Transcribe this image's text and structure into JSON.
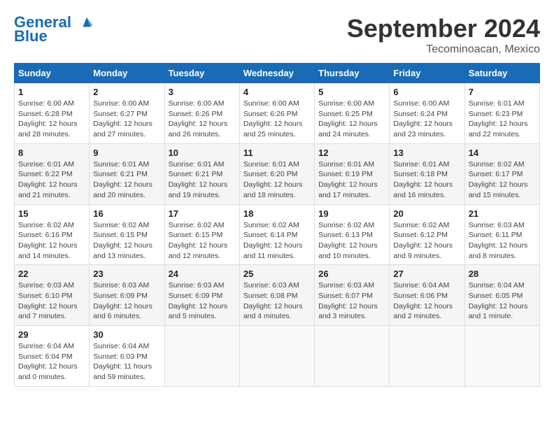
{
  "header": {
    "logo_line1": "General",
    "logo_line2": "Blue",
    "month": "September 2024",
    "location": "Tecominoacan, Mexico"
  },
  "days_of_week": [
    "Sunday",
    "Monday",
    "Tuesday",
    "Wednesday",
    "Thursday",
    "Friday",
    "Saturday"
  ],
  "weeks": [
    [
      {
        "day": "1",
        "info": "Sunrise: 6:00 AM\nSunset: 6:28 PM\nDaylight: 12 hours\nand 28 minutes."
      },
      {
        "day": "2",
        "info": "Sunrise: 6:00 AM\nSunset: 6:27 PM\nDaylight: 12 hours\nand 27 minutes."
      },
      {
        "day": "3",
        "info": "Sunrise: 6:00 AM\nSunset: 6:26 PM\nDaylight: 12 hours\nand 26 minutes."
      },
      {
        "day": "4",
        "info": "Sunrise: 6:00 AM\nSunset: 6:26 PM\nDaylight: 12 hours\nand 25 minutes."
      },
      {
        "day": "5",
        "info": "Sunrise: 6:00 AM\nSunset: 6:25 PM\nDaylight: 12 hours\nand 24 minutes."
      },
      {
        "day": "6",
        "info": "Sunrise: 6:00 AM\nSunset: 6:24 PM\nDaylight: 12 hours\nand 23 minutes."
      },
      {
        "day": "7",
        "info": "Sunrise: 6:01 AM\nSunset: 6:23 PM\nDaylight: 12 hours\nand 22 minutes."
      }
    ],
    [
      {
        "day": "8",
        "info": "Sunrise: 6:01 AM\nSunset: 6:22 PM\nDaylight: 12 hours\nand 21 minutes."
      },
      {
        "day": "9",
        "info": "Sunrise: 6:01 AM\nSunset: 6:21 PM\nDaylight: 12 hours\nand 20 minutes."
      },
      {
        "day": "10",
        "info": "Sunrise: 6:01 AM\nSunset: 6:21 PM\nDaylight: 12 hours\nand 19 minutes."
      },
      {
        "day": "11",
        "info": "Sunrise: 6:01 AM\nSunset: 6:20 PM\nDaylight: 12 hours\nand 18 minutes."
      },
      {
        "day": "12",
        "info": "Sunrise: 6:01 AM\nSunset: 6:19 PM\nDaylight: 12 hours\nand 17 minutes."
      },
      {
        "day": "13",
        "info": "Sunrise: 6:01 AM\nSunset: 6:18 PM\nDaylight: 12 hours\nand 16 minutes."
      },
      {
        "day": "14",
        "info": "Sunrise: 6:02 AM\nSunset: 6:17 PM\nDaylight: 12 hours\nand 15 minutes."
      }
    ],
    [
      {
        "day": "15",
        "info": "Sunrise: 6:02 AM\nSunset: 6:16 PM\nDaylight: 12 hours\nand 14 minutes."
      },
      {
        "day": "16",
        "info": "Sunrise: 6:02 AM\nSunset: 6:15 PM\nDaylight: 12 hours\nand 13 minutes."
      },
      {
        "day": "17",
        "info": "Sunrise: 6:02 AM\nSunset: 6:15 PM\nDaylight: 12 hours\nand 12 minutes."
      },
      {
        "day": "18",
        "info": "Sunrise: 6:02 AM\nSunset: 6:14 PM\nDaylight: 12 hours\nand 11 minutes."
      },
      {
        "day": "19",
        "info": "Sunrise: 6:02 AM\nSunset: 6:13 PM\nDaylight: 12 hours\nand 10 minutes."
      },
      {
        "day": "20",
        "info": "Sunrise: 6:02 AM\nSunset: 6:12 PM\nDaylight: 12 hours\nand 9 minutes."
      },
      {
        "day": "21",
        "info": "Sunrise: 6:03 AM\nSunset: 6:11 PM\nDaylight: 12 hours\nand 8 minutes."
      }
    ],
    [
      {
        "day": "22",
        "info": "Sunrise: 6:03 AM\nSunset: 6:10 PM\nDaylight: 12 hours\nand 7 minutes."
      },
      {
        "day": "23",
        "info": "Sunrise: 6:03 AM\nSunset: 6:09 PM\nDaylight: 12 hours\nand 6 minutes."
      },
      {
        "day": "24",
        "info": "Sunrise: 6:03 AM\nSunset: 6:09 PM\nDaylight: 12 hours\nand 5 minutes."
      },
      {
        "day": "25",
        "info": "Sunrise: 6:03 AM\nSunset: 6:08 PM\nDaylight: 12 hours\nand 4 minutes."
      },
      {
        "day": "26",
        "info": "Sunrise: 6:03 AM\nSunset: 6:07 PM\nDaylight: 12 hours\nand 3 minutes."
      },
      {
        "day": "27",
        "info": "Sunrise: 6:04 AM\nSunset: 6:06 PM\nDaylight: 12 hours\nand 2 minutes."
      },
      {
        "day": "28",
        "info": "Sunrise: 6:04 AM\nSunset: 6:05 PM\nDaylight: 12 hours\nand 1 minute."
      }
    ],
    [
      {
        "day": "29",
        "info": "Sunrise: 6:04 AM\nSunset: 6:04 PM\nDaylight: 12 hours\nand 0 minutes."
      },
      {
        "day": "30",
        "info": "Sunrise: 6:04 AM\nSunset: 6:03 PM\nDaylight: 11 hours\nand 59 minutes."
      },
      {
        "day": "",
        "info": ""
      },
      {
        "day": "",
        "info": ""
      },
      {
        "day": "",
        "info": ""
      },
      {
        "day": "",
        "info": ""
      },
      {
        "day": "",
        "info": ""
      }
    ]
  ]
}
